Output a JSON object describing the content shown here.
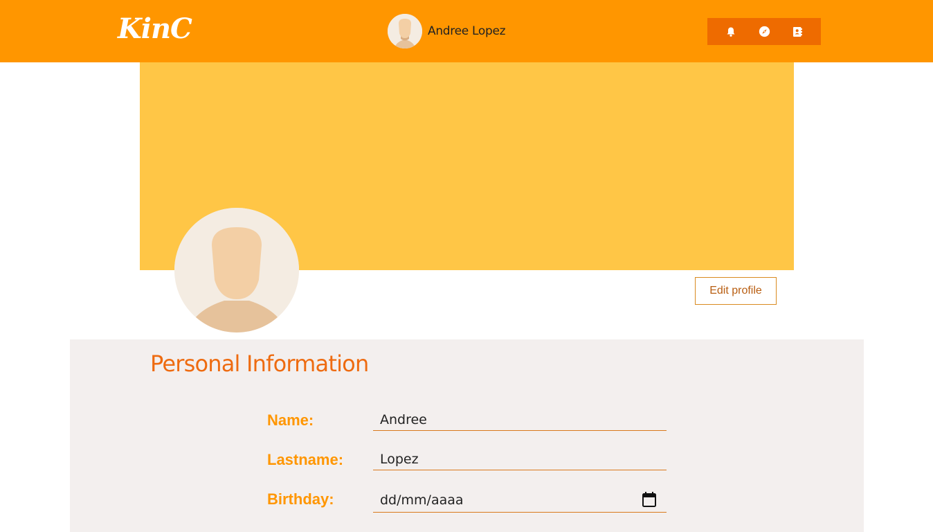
{
  "header": {
    "logo": "KinC",
    "user_name": "Andree Lopez",
    "icons": [
      "bell-icon",
      "compass-icon",
      "contacts-icon"
    ],
    "accent_color": "#ff9600",
    "icon_group_color": "#ee6b00"
  },
  "profile": {
    "cover_color": "#ffc646",
    "edit_button_label": "Edit profile"
  },
  "personal_info": {
    "title": "Personal Information",
    "fields": [
      {
        "label": "Name:",
        "value": "Andree"
      },
      {
        "label": "Lastname:",
        "value": "Lopez"
      },
      {
        "label": "Birthday:",
        "value": "dd/mm/aaaa"
      }
    ]
  }
}
